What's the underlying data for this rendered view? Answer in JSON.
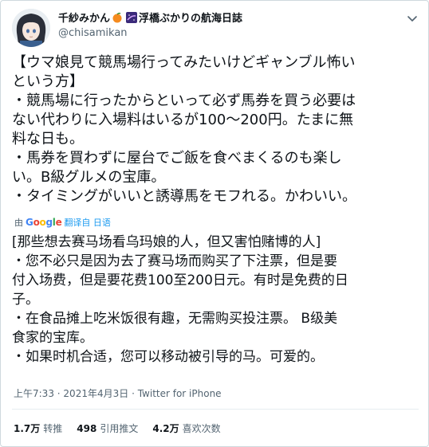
{
  "author": {
    "name_prefix": "千紗みかん",
    "name_suffix": "浮橋ぶかりの航海日誌",
    "handle": "@chisamikan"
  },
  "original_tweet": [
    "【ウマ娘見て競馬場行ってみたいけどギャンブル怖い",
    "という方】",
    "・競馬場に行ったからといって必ず馬券を買う必要は",
    "ない代わりに入場料はいるが100〜200円。たまに無",
    "料な日も。",
    "・馬券を買わずに屋台でご飯を食べまくるのも楽し",
    "い。B級グルメの宝庫。",
    "・タイミングがいいと誘導馬をモフれる。かわいい。"
  ],
  "translation_bar": {
    "by_label": "由",
    "google": "Google",
    "translated_from": "翻译自 日语"
  },
  "translated_tweet": [
    "[那些想去赛马场看乌玛娘的人，但又害怕赌博的人]",
    "・您不必只是因为去了赛马场而购买了下注票，但是要",
    "付入场费，但是要花费100至200日元。有时是免费的日",
    "子。",
    "・在食品摊上吃米饭很有趣，无需购买投注票。 B级美",
    "食家的宝库。",
    "・如果时机合适，您可以移动被引导的马。可爱的。"
  ],
  "meta": {
    "time": "上午7:33",
    "date": "2021年4月3日",
    "source": "Twitter for iPhone"
  },
  "stats": {
    "retweets_count": "1.7万",
    "retweets_label": "转推",
    "quotes_count": "498",
    "quotes_label": "引用推文",
    "likes_count": "4.2万",
    "likes_label": "喜欢次数"
  },
  "colors": {
    "link": "#1d9bf0",
    "secondary_text": "#536471",
    "border": "#cfd9de"
  },
  "icons": [
    "avatar",
    "orange-emoji",
    "galaxy-emoji",
    "chevron-down-icon",
    "google-logo"
  ]
}
